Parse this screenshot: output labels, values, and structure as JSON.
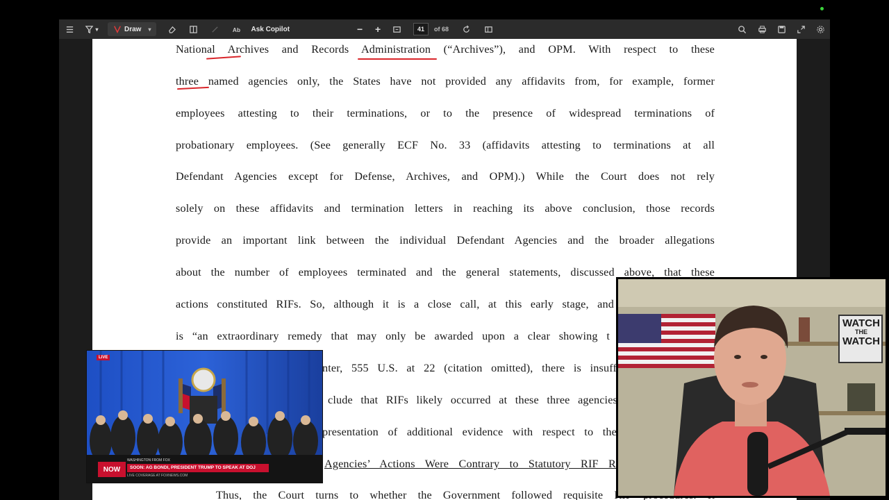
{
  "toolbar": {
    "draw_label": "Draw",
    "ask_copilot_label": "Ask Copilot",
    "current_page": "41",
    "page_total": "of 68",
    "icons": [
      "list-icon",
      "pen-icon",
      "highlighter-icon",
      "eraser-icon",
      "layout-icon",
      "text-icon",
      "read-aloud-icon",
      "zoom-out-icon",
      "zoom-in-icon",
      "fit-page-icon",
      "rotate-icon",
      "two-page-icon",
      "search-icon",
      "print-icon",
      "save-icon",
      "fullscreen-icon",
      "settings-icon"
    ]
  },
  "document": {
    "lines": [
      "National Archives and Records Administration (“Archives”), and OPM.  With respect to these",
      "three named agencies only, the States have not provided any affidavits from, for example, former",
      "employees attesting to their terminations, or to the presence of widespread terminations of",
      "probationary employees.  (See generally ECF No. 33 (affidavits attesting to terminations at all",
      "Defendant Agencies except for Defense, Archives, and OPM).)  While the Court does not rely",
      "solely on these affidavits and termination letters in reaching its above conclusion, those records",
      "provide an important link between the individual Defendant Agencies and the broader allegations",
      "about the number of employees terminated and the general statements, discussed above, that these",
      "actions constituted RIFs.  So, although it is a close call, at this early stage, and",
      "is “an extraordinary remedy that may only be awarded upon a clear showing t",
      "nter, 555 U.S. at 22 (citation omitted), there is insuff",
      "clude that RIFs likely occurred at these three agencies",
      "presentation of additional evidence with respect to the",
      "Agencies’ Actions Were Contrary to Statutory RIF R",
      "Thus, the Court turns to whether the Government followed requisite RIF procedures.  It"
    ]
  },
  "news_overlay": {
    "live_badge": "LIVE",
    "network": "NOW",
    "headline": "SOON: AG BONDI, PRESIDENT TRUMP TO SPEAK AT DOJ",
    "location_tag": "WASHINGTON FROM FOX",
    "subline": "LIVE COVERAGE AT FOXNEWS.COM"
  },
  "webcam_overlay": {
    "sign_line1": "WATCH",
    "sign_line2": "THE",
    "sign_line3": "WATCH"
  },
  "colors": {
    "toolbar_bg": "#2b2b2b",
    "annotation_red": "#d9252a",
    "news_bar_red": "#c8102e",
    "shirt": "#d9534f"
  }
}
